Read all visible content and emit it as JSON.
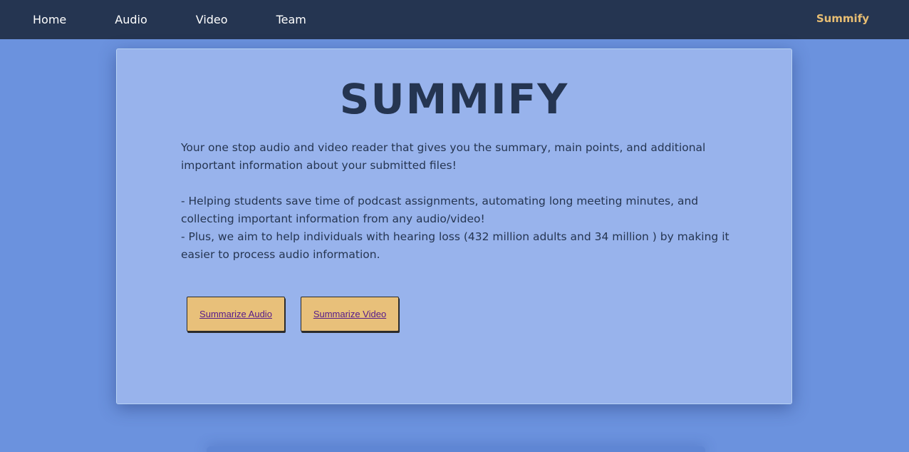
{
  "nav": {
    "links": [
      {
        "label": "Home"
      },
      {
        "label": "Audio"
      },
      {
        "label": "Video"
      },
      {
        "label": "Team"
      }
    ],
    "brand": "Summify"
  },
  "hero": {
    "title": "SUMMIFY",
    "intro": "Your one stop audio and video reader that gives you the summary, main points, and additional important information about your submitted files!",
    "point_1": "- Helping students save time of podcast assignments, automating long meeting minutes, and collecting important information from any audio/video!",
    "point_2": "- Plus, we aim to help individuals with hearing loss (432 million adults and 34 million ) by making it easier to process audio information."
  },
  "buttons": {
    "audio_label": "Summarize Audio",
    "video_label": "Summarize Video"
  },
  "colors": {
    "background": "#6b92de",
    "navbar": "#253551",
    "brand": "#e8be73",
    "card": "#98b3ec",
    "button": "#e8c07a",
    "link": "#551a8b"
  }
}
